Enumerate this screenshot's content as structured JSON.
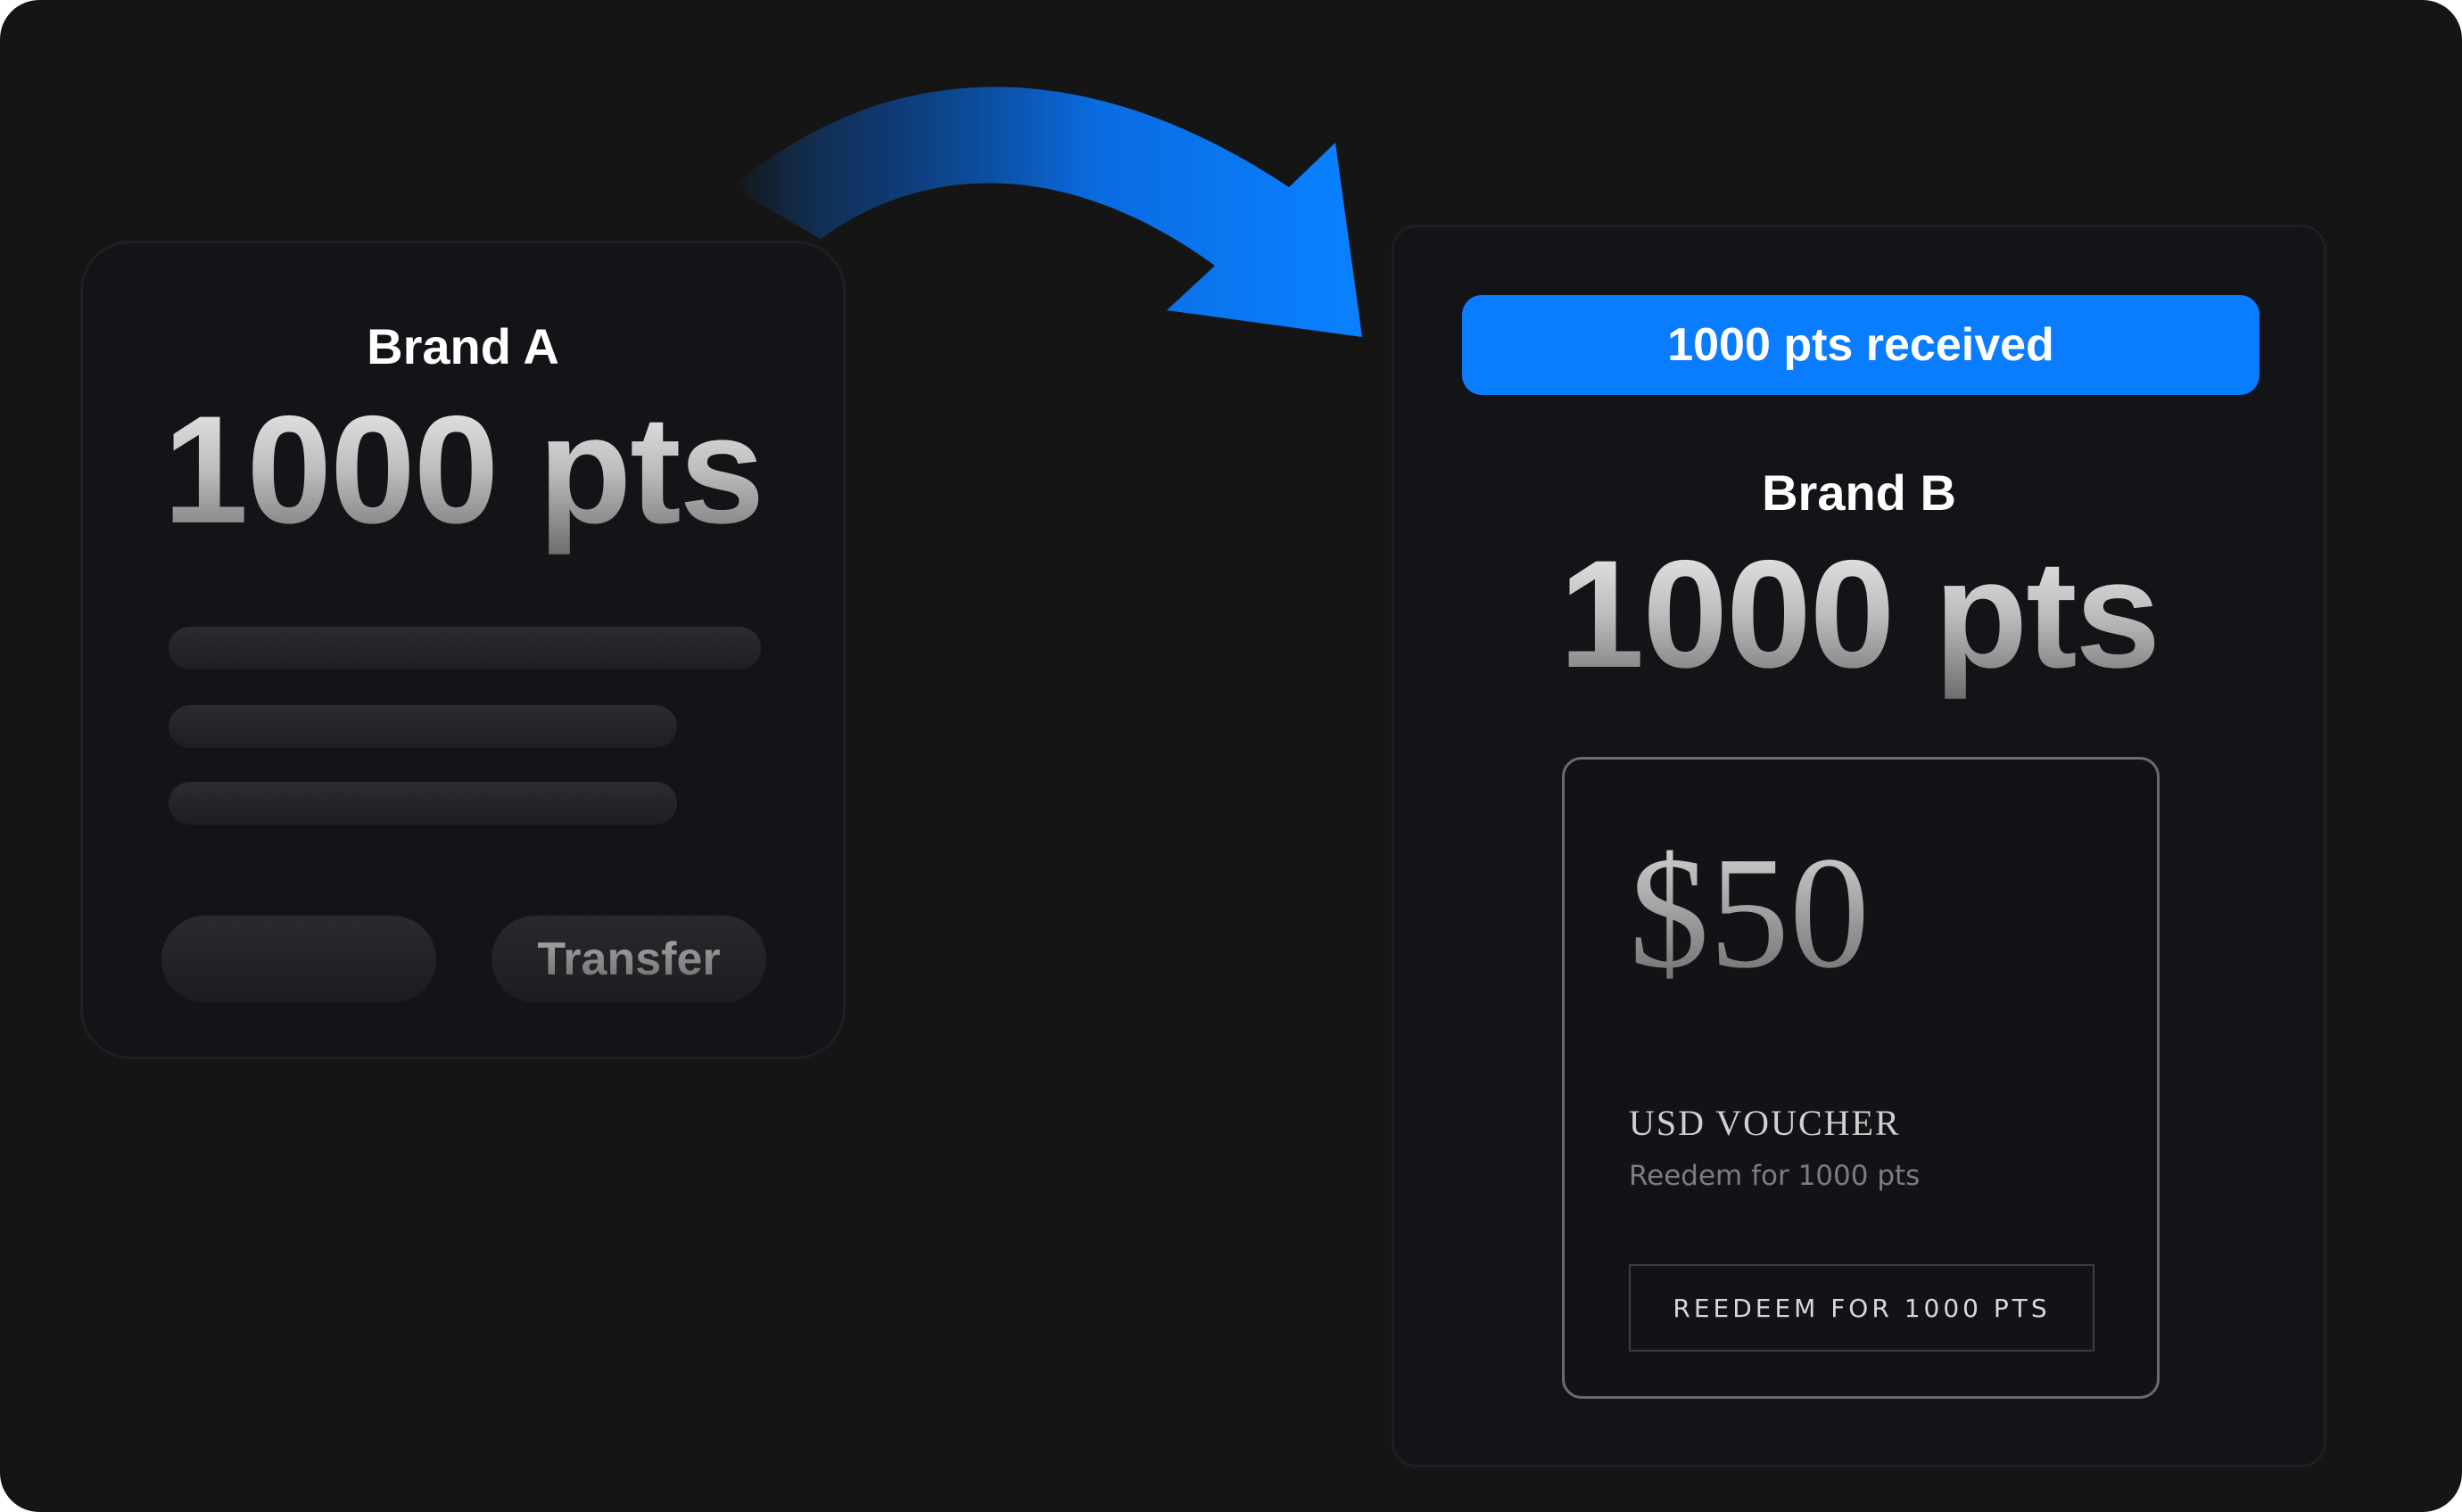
{
  "source_card": {
    "brand": "Brand A",
    "points": "1000 pts",
    "secondary_button_label": "",
    "transfer_button_label": "Transfer"
  },
  "target_card": {
    "banner": "1000 pts received",
    "brand": "Brand B",
    "points": "1000 pts",
    "voucher": {
      "amount": "$50",
      "title": "USD VOUCHER",
      "subtitle": "Reedem for 1000 pts",
      "button_label": "REEDEEM FOR 1000 PTS"
    }
  },
  "colors": {
    "background": "#151515",
    "card": "#131417",
    "accent": "#0a7cff"
  },
  "icons": {
    "transfer_arrow": "curved-arrow-icon"
  }
}
